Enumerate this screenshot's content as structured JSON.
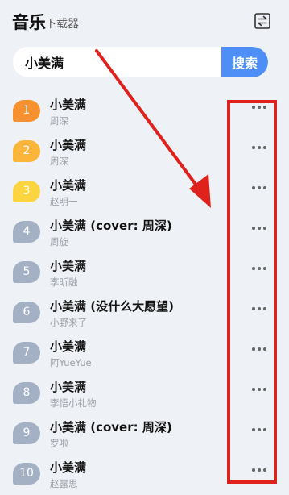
{
  "header": {
    "title": "音乐",
    "subtitle": "下载器",
    "swap_icon": "swap-icon"
  },
  "search": {
    "value": "小美满",
    "button_label": "搜索"
  },
  "colors": {
    "accent": "#4d8ff6",
    "rank_1": "#f7902f",
    "rank_2": "#fbb53b",
    "rank_3": "#fcd43f",
    "rank_default": "#a4b1c5",
    "annotation": "#e0221f"
  },
  "songs": [
    {
      "rank": "1",
      "title": "小美满",
      "artist": "周深"
    },
    {
      "rank": "2",
      "title": "小美满",
      "artist": "周深"
    },
    {
      "rank": "3",
      "title": "小美满",
      "artist": "赵明一"
    },
    {
      "rank": "4",
      "title": "小美满 (cover: 周深)",
      "artist": "周旋"
    },
    {
      "rank": "5",
      "title": "小美满",
      "artist": "李昕融"
    },
    {
      "rank": "6",
      "title": "小美满 (没什么大愿望)",
      "artist": "小野来了"
    },
    {
      "rank": "7",
      "title": "小美满",
      "artist": "阿YueYue"
    },
    {
      "rank": "8",
      "title": "小美满",
      "artist": "李悟小礼物"
    },
    {
      "rank": "9",
      "title": "小美满 (cover: 周深)",
      "artist": "罗啦"
    },
    {
      "rank": "10",
      "title": "小美满",
      "artist": "赵露思"
    }
  ],
  "row_action_icon": "more-icon"
}
